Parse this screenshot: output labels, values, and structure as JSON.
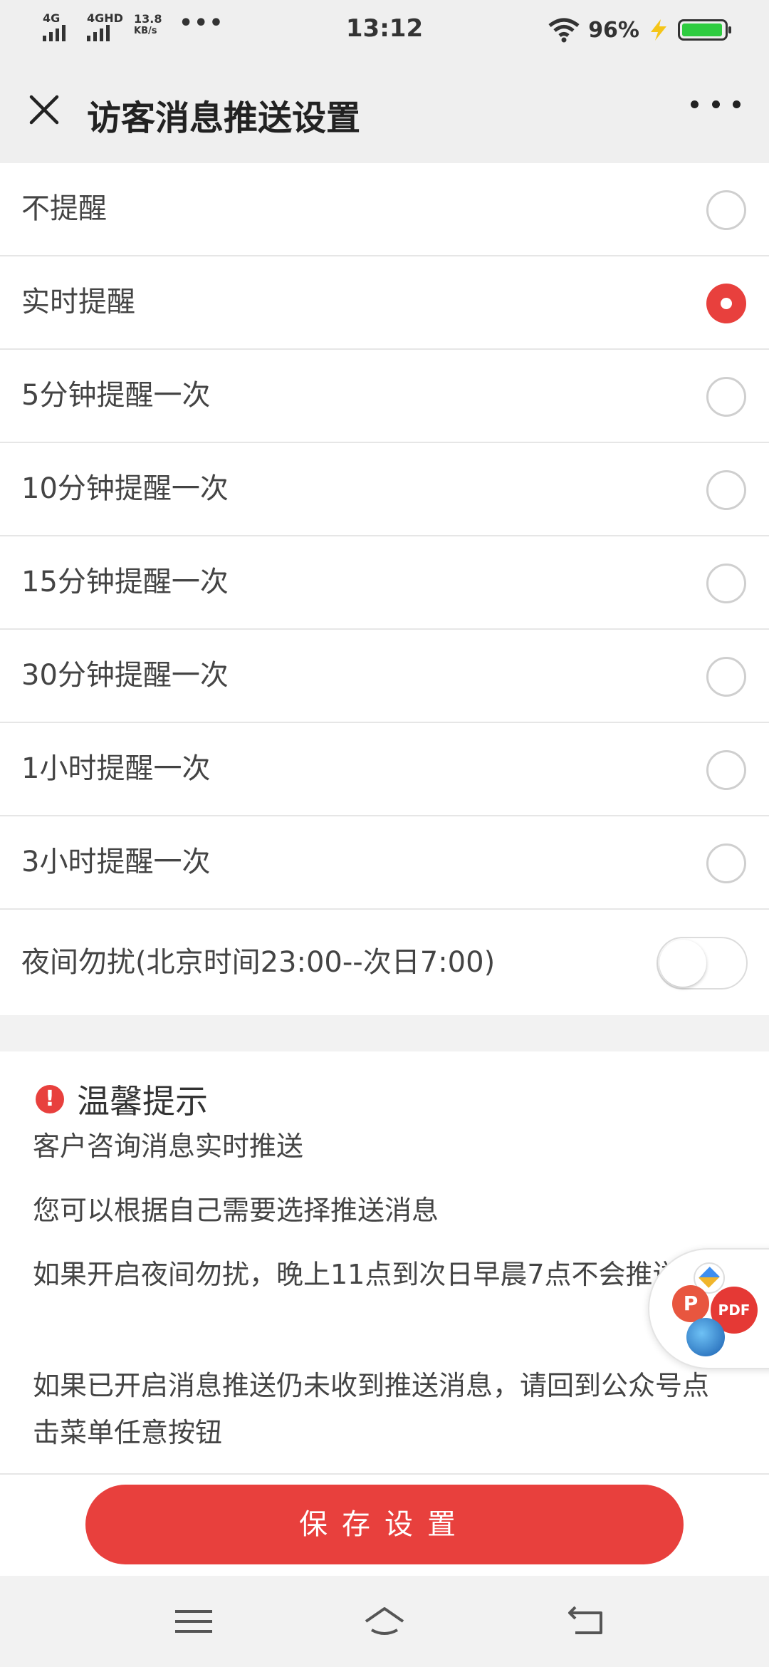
{
  "status_bar": {
    "network1": "4G",
    "network2": "4GHD",
    "speed_value": "13.8",
    "speed_unit": "KB/s",
    "dots": "•••",
    "time": "13:12",
    "battery_percent": "96%",
    "battery_level": 0.96,
    "battery_color": "#2ecc40"
  },
  "header": {
    "title": "访客消息推送设置",
    "close_icon": "close-icon",
    "more_icon": "more-icon"
  },
  "options": [
    {
      "label": "不提醒",
      "selected": false
    },
    {
      "label": "实时提醒",
      "selected": true
    },
    {
      "label": "5分钟提醒一次",
      "selected": false
    },
    {
      "label": "10分钟提醒一次",
      "selected": false
    },
    {
      "label": "15分钟提醒一次",
      "selected": false
    },
    {
      "label": "30分钟提醒一次",
      "selected": false
    },
    {
      "label": "1小时提醒一次",
      "selected": false
    },
    {
      "label": "3小时提醒一次",
      "selected": false
    }
  ],
  "night_mode": {
    "label": "夜间勿扰(北京时间23:00--次日7:00)",
    "enabled": false
  },
  "tips": {
    "title": "温馨提示",
    "items": [
      "客户咨询消息实时推送",
      "您可以根据自己需要选择推送消息",
      "如果开启夜间勿扰，晚上11点到次日早晨7点不会推送",
      "如果已开启消息推送仍未收到推送消息，请回到公众号点击菜单任意按钮"
    ]
  },
  "float_widget": {
    "p_label": "P",
    "pdf_label": "PDF"
  },
  "save_button": {
    "label": "保存设置"
  },
  "colors": {
    "accent": "#e8403d"
  },
  "nav_bar": {
    "icons": [
      "menu-icon",
      "home-icon",
      "back-icon"
    ]
  }
}
